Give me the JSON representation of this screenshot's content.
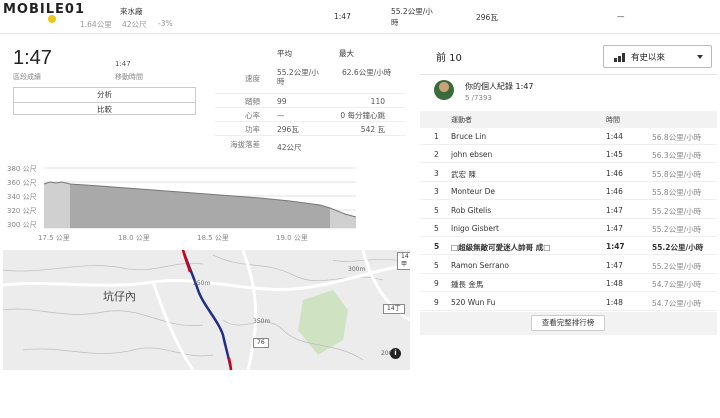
{
  "top": {
    "logo": "MOBILE01",
    "prev_segment_name": "來水廠",
    "prev_sub1": "1.64公里",
    "prev_sub2": "42公尺",
    "prev_sub3": "-3%",
    "prev_time": "1:47",
    "prev_speed": "55.2公里/小時",
    "prev_power": "296瓦",
    "prev_dash": "—"
  },
  "summary": {
    "time": "1:47",
    "time_label": "區段成績",
    "moving_time": "1:47",
    "moving_time_label": "移動時間",
    "analyze_button": "分析",
    "compare_button": "比較"
  },
  "stats": {
    "header_avg": "平均",
    "header_max": "最大",
    "rows": [
      {
        "label": "速度",
        "avg": "55.2公里/小時",
        "max": "62.6公里/小時"
      },
      {
        "label": "踏頻",
        "avg": "99",
        "max": "110"
      },
      {
        "label": "心率",
        "avg": "—",
        "max": "0 每分鐘心跳"
      },
      {
        "label": "功率",
        "avg": "296瓦",
        "max": "542 瓦"
      },
      {
        "label": "海拔落差",
        "avg": "42公尺",
        "max": ""
      }
    ]
  },
  "elevation": {
    "y_ticks": [
      "380 公尺",
      "360 公尺",
      "340 公尺",
      "320 公尺",
      "300 公尺"
    ],
    "x_ticks": [
      "17.5 公里",
      "18.0 公里",
      "18.5 公里",
      "19.0 公里"
    ]
  },
  "map": {
    "place_label": "坑仔內",
    "road_labels": [
      "300m",
      "350m",
      "250m",
      "200m",
      "150m",
      "100m",
      "350m"
    ],
    "badges": [
      "14甲",
      "14丁",
      "76",
      "14"
    ],
    "info": "i"
  },
  "leaderboard": {
    "title": "前 10",
    "filter_label": "有史以來",
    "pr_title": "你的個人紀錄 1:47",
    "pr_rank": "5 /7393",
    "col_athlete": "運動者",
    "col_time": "時間",
    "rows": [
      {
        "rank": "1",
        "name": "Bruce Lin",
        "time": "1:44",
        "speed": "56.8公里/小時"
      },
      {
        "rank": "2",
        "name": "john ebsen",
        "time": "1:45",
        "speed": "56.3公里/小時"
      },
      {
        "rank": "3",
        "name": "武宏 陳",
        "time": "1:46",
        "speed": "55.8公里/小時"
      },
      {
        "rank": "3",
        "name": "Monteur De",
        "time": "1:46",
        "speed": "55.8公里/小時"
      },
      {
        "rank": "5",
        "name": "Rob Gitelis",
        "time": "1:47",
        "speed": "55.2公里/小時"
      },
      {
        "rank": "5",
        "name": "Inigo Gisbert",
        "time": "1:47",
        "speed": "55.2公里/小時"
      },
      {
        "rank": "5",
        "name": "□超級無敵可愛迷人帥哥 成□",
        "time": "1:47",
        "speed": "55.2公里/小時",
        "me": true
      },
      {
        "rank": "5",
        "name": "Ramon Serrano",
        "time": "1:47",
        "speed": "55.2公里/小時"
      },
      {
        "rank": "9",
        "name": "鍾長 金馬",
        "time": "1:48",
        "speed": "54.7公里/小時"
      },
      {
        "rank": "9",
        "name": "520 Wun Fu",
        "time": "1:48",
        "speed": "54.7公里/小時"
      }
    ],
    "view_all": "查看完整排行榜"
  }
}
